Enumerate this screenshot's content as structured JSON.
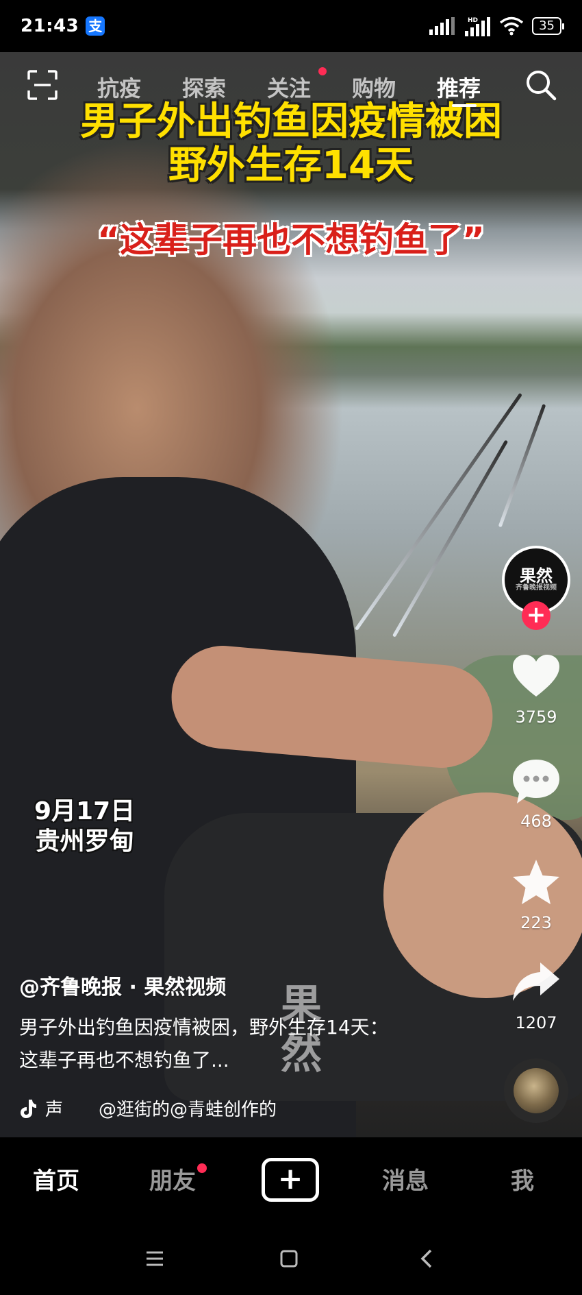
{
  "status_bar": {
    "time": "21:43",
    "alipay_badge": "支",
    "network_label": "HD",
    "battery": "35"
  },
  "top_nav": {
    "tabs": [
      {
        "label": "抗疫",
        "active": false
      },
      {
        "label": "探索",
        "active": false
      },
      {
        "label": "关注",
        "active": false,
        "has_dot": true
      },
      {
        "label": "购物",
        "active": false
      },
      {
        "label": "推荐",
        "active": true
      }
    ],
    "icons": [
      "scan-icon",
      "search-icon"
    ]
  },
  "video": {
    "headline_line1": "男子外出钓鱼因疫情被困",
    "headline_line2": "野外生存14天",
    "quote": "“这辈子再也不想钓鱼了”",
    "date": "9月17日",
    "place": "贵州罗甸",
    "watermark": "果然"
  },
  "right_rail": {
    "avatar_text": "果然",
    "avatar_sub": "齐鲁晚报视频",
    "likes": "3759",
    "comments": "468",
    "favorites": "223",
    "shares": "1207",
    "colors": {
      "follow": "#ff2c55"
    }
  },
  "caption": {
    "author": "@齐鲁晚报 · 果然视频",
    "line1": "男子外出钓鱼因疫情被困，野外生存14天：",
    "line2": "这辈子再也不想钓鱼了..."
  },
  "music": {
    "text": "声　　@逛街的@青蛙创作的"
  },
  "bottom_nav": {
    "home": "首页",
    "friends": "朋友",
    "create": "+",
    "messages": "消息",
    "me": "我"
  },
  "colors": {
    "headline": "#ffe000",
    "quote": "#d9201a",
    "accent": "#ff2c55"
  }
}
